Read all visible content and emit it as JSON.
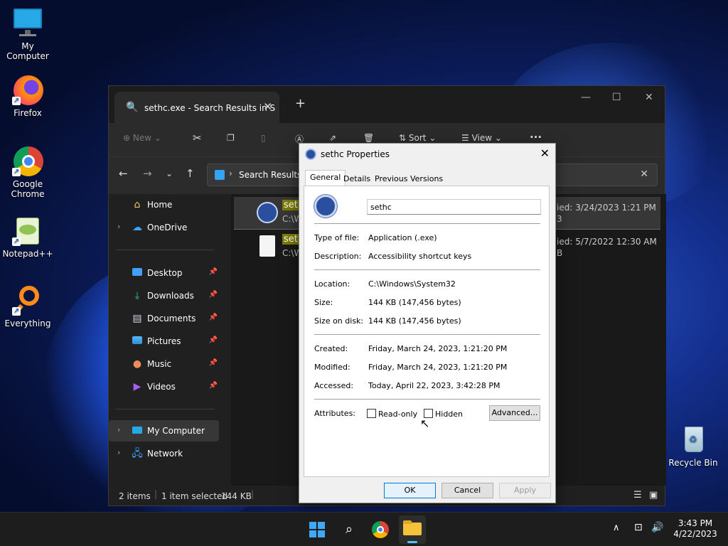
{
  "desktop": {
    "icons": [
      {
        "label": "My Computer"
      },
      {
        "label": "Firefox"
      },
      {
        "label": "Google Chrome"
      },
      {
        "label": "Notepad++"
      },
      {
        "label": "Everything"
      },
      {
        "label": "Recycle Bin"
      }
    ]
  },
  "explorer": {
    "tab_title": "sethc.exe - Search Results in S",
    "toolbar": {
      "new_label": "New",
      "sort_label": "Sort",
      "view_label": "View",
      "more_label": "···"
    },
    "address": "Search Results in",
    "sidebar": {
      "home": "Home",
      "onedrive": "OneDrive",
      "desktop": "Desktop",
      "downloads": "Downloads",
      "documents": "Documents",
      "pictures": "Pictures",
      "music": "Music",
      "videos": "Videos",
      "mycomputer": "My Computer",
      "network": "Network"
    },
    "files": [
      {
        "name": "seth",
        "path": "C:\\W",
        "modified": "ied: 3/24/2023 1:21 PM",
        "size": "3"
      },
      {
        "name": "seth",
        "path": "C:\\W",
        "modified": "ied: 5/7/2022 12:30 AM",
        "size": "B"
      }
    ],
    "status": {
      "items": "2 items",
      "selected": "1 item selected",
      "size": "144 KB"
    }
  },
  "dialog": {
    "title": "sethc Properties",
    "tabs": [
      "General",
      "Details",
      "Previous Versions"
    ],
    "name_value": "sethc",
    "type_label": "Type of file:",
    "type_value": "Application (.exe)",
    "desc_label": "Description:",
    "desc_value": "Accessibility shortcut keys",
    "location_label": "Location:",
    "location_value": "C:\\Windows\\System32",
    "size_label": "Size:",
    "size_value": "144 KB (147,456 bytes)",
    "disk_label": "Size on disk:",
    "disk_value": "144 KB (147,456 bytes)",
    "created_label": "Created:",
    "created_value": "Friday, March 24, 2023, 1:21:20 PM",
    "modified_label": "Modified:",
    "modified_value": "Friday, March 24, 2023, 1:21:20 PM",
    "accessed_label": "Accessed:",
    "accessed_value": "Today, April 22, 2023, 3:42:28 PM",
    "attributes_label": "Attributes:",
    "readonly_label": "Read-only",
    "hidden_label": "Hidden",
    "advanced_label": "Advanced...",
    "ok_label": "OK",
    "cancel_label": "Cancel",
    "apply_label": "Apply"
  },
  "taskbar": {
    "time": "3:43 PM",
    "date": "4/22/2023"
  }
}
